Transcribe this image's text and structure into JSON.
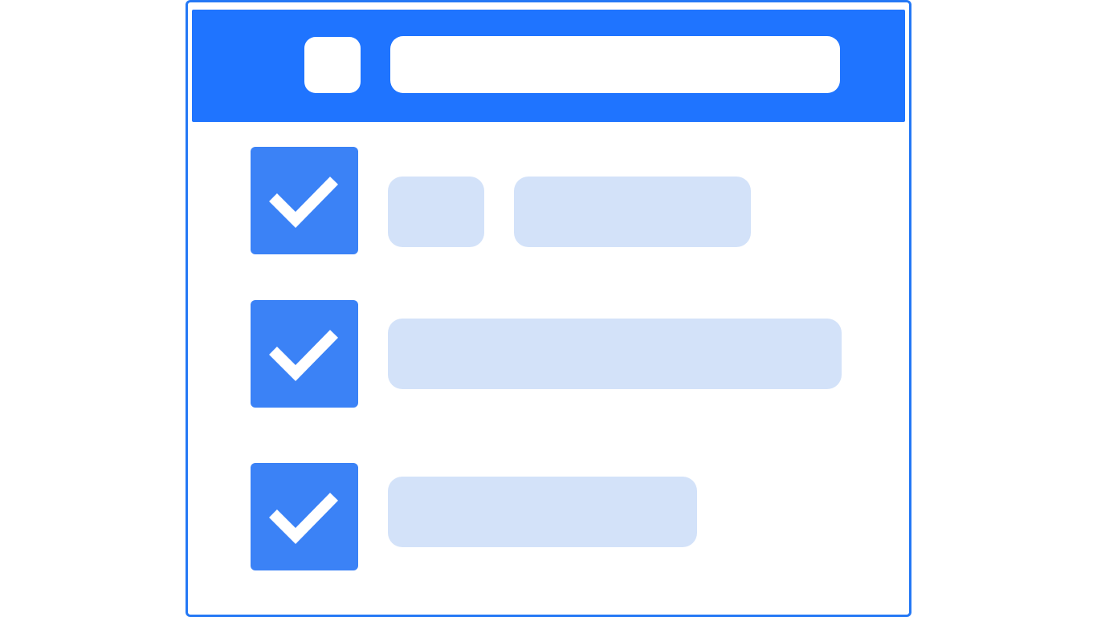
{
  "colors": {
    "header": "#1f74ff",
    "frame": "#2478f5",
    "checkbox": "#3b82f6",
    "placeholder": "#d3e2f9",
    "background": "#ffffff"
  },
  "header": {
    "icon": "square-placeholder-icon",
    "search_bar": "placeholder-bar"
  },
  "items": [
    {
      "checked": true,
      "icon": "check-icon"
    },
    {
      "checked": true,
      "icon": "check-icon"
    },
    {
      "checked": true,
      "icon": "check-icon"
    }
  ]
}
